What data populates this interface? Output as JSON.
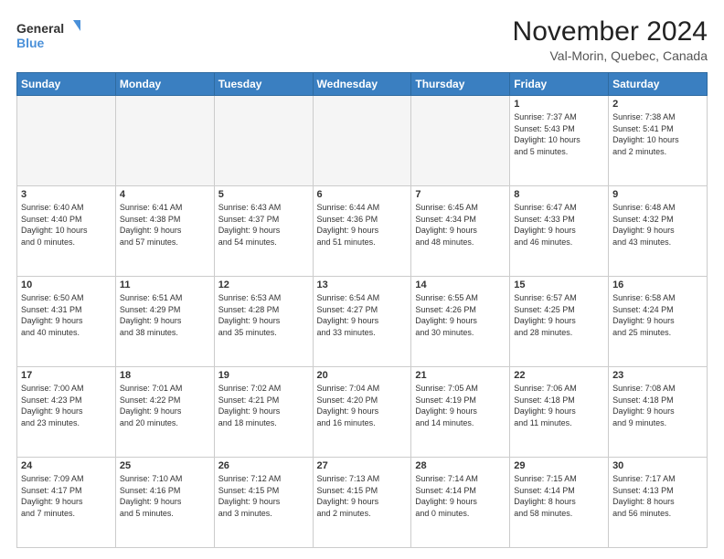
{
  "logo": {
    "line1": "General",
    "line2": "Blue"
  },
  "header": {
    "month": "November 2024",
    "location": "Val-Morin, Quebec, Canada"
  },
  "days_of_week": [
    "Sunday",
    "Monday",
    "Tuesday",
    "Wednesday",
    "Thursday",
    "Friday",
    "Saturday"
  ],
  "weeks": [
    [
      {
        "num": "",
        "info": ""
      },
      {
        "num": "",
        "info": ""
      },
      {
        "num": "",
        "info": ""
      },
      {
        "num": "",
        "info": ""
      },
      {
        "num": "",
        "info": ""
      },
      {
        "num": "1",
        "info": "Sunrise: 7:37 AM\nSunset: 5:43 PM\nDaylight: 10 hours\nand 5 minutes."
      },
      {
        "num": "2",
        "info": "Sunrise: 7:38 AM\nSunset: 5:41 PM\nDaylight: 10 hours\nand 2 minutes."
      }
    ],
    [
      {
        "num": "3",
        "info": "Sunrise: 6:40 AM\nSunset: 4:40 PM\nDaylight: 10 hours\nand 0 minutes."
      },
      {
        "num": "4",
        "info": "Sunrise: 6:41 AM\nSunset: 4:38 PM\nDaylight: 9 hours\nand 57 minutes."
      },
      {
        "num": "5",
        "info": "Sunrise: 6:43 AM\nSunset: 4:37 PM\nDaylight: 9 hours\nand 54 minutes."
      },
      {
        "num": "6",
        "info": "Sunrise: 6:44 AM\nSunset: 4:36 PM\nDaylight: 9 hours\nand 51 minutes."
      },
      {
        "num": "7",
        "info": "Sunrise: 6:45 AM\nSunset: 4:34 PM\nDaylight: 9 hours\nand 48 minutes."
      },
      {
        "num": "8",
        "info": "Sunrise: 6:47 AM\nSunset: 4:33 PM\nDaylight: 9 hours\nand 46 minutes."
      },
      {
        "num": "9",
        "info": "Sunrise: 6:48 AM\nSunset: 4:32 PM\nDaylight: 9 hours\nand 43 minutes."
      }
    ],
    [
      {
        "num": "10",
        "info": "Sunrise: 6:50 AM\nSunset: 4:31 PM\nDaylight: 9 hours\nand 40 minutes."
      },
      {
        "num": "11",
        "info": "Sunrise: 6:51 AM\nSunset: 4:29 PM\nDaylight: 9 hours\nand 38 minutes."
      },
      {
        "num": "12",
        "info": "Sunrise: 6:53 AM\nSunset: 4:28 PM\nDaylight: 9 hours\nand 35 minutes."
      },
      {
        "num": "13",
        "info": "Sunrise: 6:54 AM\nSunset: 4:27 PM\nDaylight: 9 hours\nand 33 minutes."
      },
      {
        "num": "14",
        "info": "Sunrise: 6:55 AM\nSunset: 4:26 PM\nDaylight: 9 hours\nand 30 minutes."
      },
      {
        "num": "15",
        "info": "Sunrise: 6:57 AM\nSunset: 4:25 PM\nDaylight: 9 hours\nand 28 minutes."
      },
      {
        "num": "16",
        "info": "Sunrise: 6:58 AM\nSunset: 4:24 PM\nDaylight: 9 hours\nand 25 minutes."
      }
    ],
    [
      {
        "num": "17",
        "info": "Sunrise: 7:00 AM\nSunset: 4:23 PM\nDaylight: 9 hours\nand 23 minutes."
      },
      {
        "num": "18",
        "info": "Sunrise: 7:01 AM\nSunset: 4:22 PM\nDaylight: 9 hours\nand 20 minutes."
      },
      {
        "num": "19",
        "info": "Sunrise: 7:02 AM\nSunset: 4:21 PM\nDaylight: 9 hours\nand 18 minutes."
      },
      {
        "num": "20",
        "info": "Sunrise: 7:04 AM\nSunset: 4:20 PM\nDaylight: 9 hours\nand 16 minutes."
      },
      {
        "num": "21",
        "info": "Sunrise: 7:05 AM\nSunset: 4:19 PM\nDaylight: 9 hours\nand 14 minutes."
      },
      {
        "num": "22",
        "info": "Sunrise: 7:06 AM\nSunset: 4:18 PM\nDaylight: 9 hours\nand 11 minutes."
      },
      {
        "num": "23",
        "info": "Sunrise: 7:08 AM\nSunset: 4:18 PM\nDaylight: 9 hours\nand 9 minutes."
      }
    ],
    [
      {
        "num": "24",
        "info": "Sunrise: 7:09 AM\nSunset: 4:17 PM\nDaylight: 9 hours\nand 7 minutes."
      },
      {
        "num": "25",
        "info": "Sunrise: 7:10 AM\nSunset: 4:16 PM\nDaylight: 9 hours\nand 5 minutes."
      },
      {
        "num": "26",
        "info": "Sunrise: 7:12 AM\nSunset: 4:15 PM\nDaylight: 9 hours\nand 3 minutes."
      },
      {
        "num": "27",
        "info": "Sunrise: 7:13 AM\nSunset: 4:15 PM\nDaylight: 9 hours\nand 2 minutes."
      },
      {
        "num": "28",
        "info": "Sunrise: 7:14 AM\nSunset: 4:14 PM\nDaylight: 9 hours\nand 0 minutes."
      },
      {
        "num": "29",
        "info": "Sunrise: 7:15 AM\nSunset: 4:14 PM\nDaylight: 8 hours\nand 58 minutes."
      },
      {
        "num": "30",
        "info": "Sunrise: 7:17 AM\nSunset: 4:13 PM\nDaylight: 8 hours\nand 56 minutes."
      }
    ]
  ]
}
